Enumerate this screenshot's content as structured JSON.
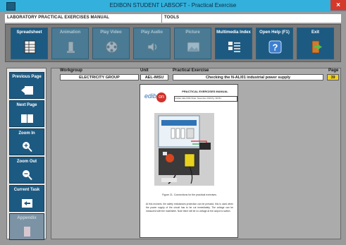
{
  "window": {
    "title": "EDIBON STUDENT LABSOFT - Practical Exercise",
    "close_glyph": "×"
  },
  "menubar": {
    "left_label": "LABORATORY PRACTICAL EXERCISES MANUAL",
    "right_label": "TOOLS"
  },
  "toolbar": {
    "buttons": [
      {
        "label": "Spreadsheet",
        "icon": "spreadsheet-icon",
        "state": "active"
      },
      {
        "label": "Animation",
        "icon": "animation-icon",
        "state": "disabled"
      },
      {
        "label": "Play Video",
        "icon": "film-reel-icon",
        "state": "disabled"
      },
      {
        "label": "Play Audio",
        "icon": "audio-icon",
        "state": "disabled"
      },
      {
        "label": "Picture",
        "icon": "picture-icon",
        "state": "disabled"
      },
      {
        "label": "Multimedia Index",
        "icon": "multimedia-index-icon",
        "state": "active"
      },
      {
        "label": "Open Help (F1)",
        "icon": "help-icon",
        "state": "active"
      },
      {
        "label": "Exit",
        "icon": "exit-door-icon",
        "state": "active"
      }
    ]
  },
  "sidebar": {
    "buttons": [
      {
        "label": "Previous Page",
        "icon": "previous-page-icon",
        "state": "active"
      },
      {
        "label": "Next Page",
        "icon": "next-page-icon",
        "state": "active"
      },
      {
        "label": "Zoom In",
        "icon": "zoom-in-icon",
        "state": "active"
      },
      {
        "label": "Zoom Out",
        "icon": "zoom-out-icon",
        "state": "active"
      },
      {
        "label": "Current Task",
        "icon": "current-task-icon",
        "state": "active"
      },
      {
        "label": "Appendix",
        "icon": "appendix-icon",
        "state": "disabled"
      }
    ]
  },
  "header": {
    "workgroup_label": "Workgroup",
    "workgroup_value": "ELECTRICITY GROUP",
    "unit_label": "Unit",
    "unit_value": "AEL-IMSU",
    "exercise_label": "Practical Exercise",
    "exercise_value": "Checking the N-ALI01 industrial power supply",
    "page_label": "Page",
    "page_value": "39"
  },
  "document": {
    "logo_text": "edib",
    "logo_on": "on",
    "title": "PRACTICAL EXERCISES MANUAL",
    "meta": "Unidad: AEL-IMSU     Date: November 2019     Pg. 39/151",
    "caption": "Figure 21. Connections for the practical exercises.",
    "paragraph": "At this moment, the safety resistances protection can be pressed, this is used when the power supply of the circuit has to be cut immediately. The voltage can be measured with the multimeter. Note there will be no voltage at the output to switch."
  },
  "colors": {
    "titlebar": "#33b1dc",
    "button_active": "#1d5a82",
    "button_disabled": "#4b7b94",
    "page_field": "#f2d21c",
    "close": "#d33a2c"
  }
}
